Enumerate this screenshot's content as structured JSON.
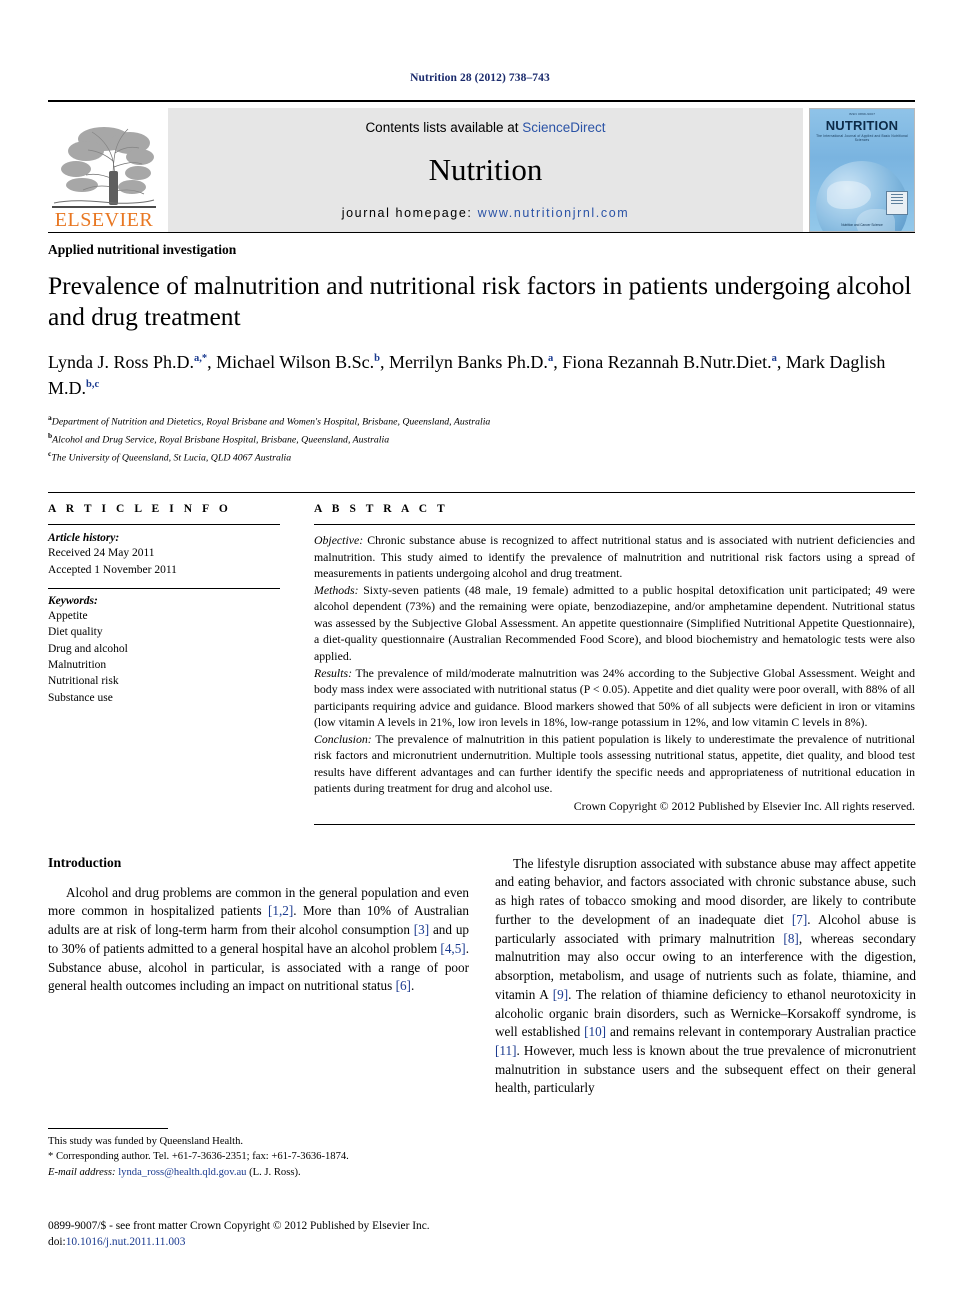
{
  "running_head": "Nutrition 28 (2012) 738–743",
  "masthead": {
    "contents_prefix": "Contents lists available at ",
    "contents_link": "ScienceDirect",
    "journal_name": "Nutrition",
    "homepage_prefix": "journal homepage: ",
    "homepage_url": "www.nutritionjrnl.com",
    "publisher_logo_text": "ELSEVIER",
    "cover": {
      "top_label": "ISSN 0899-9007",
      "title": "NUTRITION",
      "subtitle": "The International Journal of Applied and Basic Nutritional Sciences",
      "foot": "Nutrition and Cancer Science"
    }
  },
  "article": {
    "section_kind": "Applied nutritional investigation",
    "title": "Prevalence of malnutrition and nutritional risk factors in patients undergoing alcohol and drug treatment",
    "authors": [
      {
        "name": "Lynda J. Ross Ph.D.",
        "marks": "a,*",
        "sep": ", "
      },
      {
        "name": "Michael Wilson B.Sc.",
        "marks": "b",
        "sep": ", "
      },
      {
        "name": "Merrilyn Banks Ph.D.",
        "marks": "a",
        "sep": ", "
      },
      {
        "name": "Fiona Rezannah B.Nutr.Diet.",
        "marks": "a",
        "sep": ", "
      },
      {
        "name": "Mark Daglish M.D.",
        "marks": "b,c",
        "sep": ""
      }
    ],
    "affiliations": [
      {
        "mark": "a",
        "text": "Department of Nutrition and Dietetics, Royal Brisbane and Women's Hospital, Brisbane, Queensland, Australia"
      },
      {
        "mark": "b",
        "text": "Alcohol and Drug Service, Royal Brisbane Hospital, Brisbane, Queensland, Australia"
      },
      {
        "mark": "c",
        "text": "The University of Queensland, St Lucia, QLD 4067 Australia"
      }
    ]
  },
  "article_info": {
    "label": "A R T I C L E  I N F O",
    "history_title": "Article history:",
    "history": [
      "Received 24 May 2011",
      "Accepted 1 November 2011"
    ],
    "keywords_title": "Keywords:",
    "keywords": [
      "Appetite",
      "Diet quality",
      "Drug and alcohol",
      "Malnutrition",
      "Nutritional risk",
      "Substance use"
    ]
  },
  "abstract": {
    "label": "A B S T R A C T",
    "objective_label": "Objective:",
    "objective_text": " Chronic substance abuse is recognized to affect nutritional status and is associated with nutrient deficiencies and malnutrition. This study aimed to identify the prevalence of malnutrition and nutritional risk factors using a spread of measurements in patients undergoing alcohol and drug treatment.",
    "methods_label": "Methods:",
    "methods_text": " Sixty-seven patients (48 male, 19 female) admitted to a public hospital detoxification unit participated; 49 were alcohol dependent (73%) and the remaining were opiate, benzodiazepine, and/or amphetamine dependent. Nutritional status was assessed by the Subjective Global Assessment. An appetite questionnaire (Simplified Nutritional Appetite Questionnaire), a diet-quality questionnaire (Australian Recommended Food Score), and blood biochemistry and hematologic tests were also applied.",
    "results_label": "Results:",
    "results_text": " The prevalence of mild/moderate malnutrition was 24% according to the Subjective Global Assessment. Weight and body mass index were associated with nutritional status (P < 0.05). Appetite and diet quality were poor overall, with 88% of all participants requiring advice and guidance. Blood markers showed that 50% of all subjects were deficient in iron or vitamins (low vitamin A levels in 21%, low iron levels in 18%, low-range potassium in 12%, and low vitamin C levels in 8%).",
    "conclusion_label": "Conclusion:",
    "conclusion_text": " The prevalence of malnutrition in this patient population is likely to underestimate the prevalence of nutritional risk factors and micronutrient undernutrition. Multiple tools assessing nutritional status, appetite, diet quality, and blood test results have different advantages and can further identify the specific needs and appropriateness of nutritional education in patients during treatment for drug and alcohol use.",
    "copyright": "Crown Copyright © 2012 Published by Elsevier Inc. All rights reserved."
  },
  "body": {
    "intro_heading": "Introduction",
    "left_paragraph_parts": [
      "Alcohol and drug problems are common in the general population and even more common in hospitalized patients ",
      "[1,2]",
      ". More than 10% of Australian adults are at risk of long-term harm from their alcohol consumption ",
      "[3]",
      " and up to 30% of patients admitted to a general hospital have an alcohol problem ",
      "[4,5]",
      ". Substance abuse, alcohol in particular, is associated with a range of poor general health outcomes including an impact on nutritional status ",
      "[6]",
      "."
    ],
    "right_paragraph_parts": [
      "The lifestyle disruption associated with substance abuse may affect appetite and eating behavior, and factors associated with chronic substance abuse, such as high rates of tobacco smoking and mood disorder, are likely to contribute further to the development of an inadequate diet ",
      "[7]",
      ". Alcohol abuse is particularly associated with primary malnutrition ",
      "[8]",
      ", whereas secondary malnutrition may also occur owing to an interference with the digestion, absorption, metabolism, and usage of nutrients such as folate, thiamine, and vitamin A ",
      "[9]",
      ". The relation of thiamine deficiency to ethanol neurotoxicity in alcoholic organic brain disorders, such as Wernicke–Korsakoff syndrome, is well established ",
      "[10]",
      " and remains relevant in contemporary Australian practice ",
      "[11]",
      ". However, much less is known about the true prevalence of micronutrient malnutrition in substance users and the subsequent effect on their general health, particularly"
    ]
  },
  "footnotes": {
    "funding": "This study was funded by Queensland Health.",
    "corresponding": "* Corresponding author. Tel. +61-7-3636-2351; fax: +61-7-3636-1874.",
    "email_label": "E-mail address:",
    "email": "lynda_ross@health.qld.gov.au",
    "email_suffix": " (L. J. Ross)."
  },
  "footer": {
    "issn_line": "0899-9007/$ - see front matter Crown Copyright © 2012 Published by Elsevier Inc.",
    "doi_prefix": "doi:",
    "doi": "10.1016/j.nut.2011.11.003"
  }
}
